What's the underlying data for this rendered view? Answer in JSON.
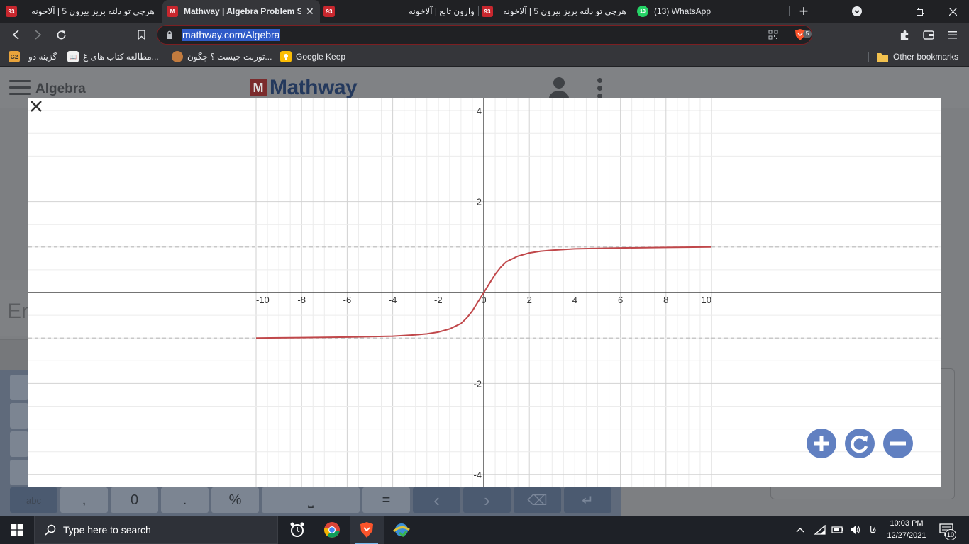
{
  "browser": {
    "tabs": [
      {
        "label": "هرچی تو دلته بریز بیرون 5 | آلاخونه",
        "favicon": "93-icon"
      },
      {
        "label": "Mathway | Algebra Problem Solver",
        "favicon": "mathway-icon",
        "active": true
      },
      {
        "label": "",
        "favicon": "93-icon"
      },
      {
        "label": "وارون تابع | آلاخونه",
        "favicon": "93-icon"
      },
      {
        "label": "هرچی تو دلته بریز بیرون 5 | آلاخونه",
        "favicon": "93-icon"
      },
      {
        "label": "(13) WhatsApp",
        "favicon": "whatsapp-icon",
        "badge": "13"
      }
    ],
    "new_tab": "+",
    "url": "mathway.com/Algebra",
    "brave_badge": "5",
    "bookmarks": [
      {
        "label": "گزینه دو"
      },
      {
        "label": "مطالعه کتاب های غ..."
      },
      {
        "label": "تورنت چیست ؟ چگون..."
      },
      {
        "label": "Google Keep"
      }
    ],
    "other_bookmarks": "Other bookmarks"
  },
  "mathway": {
    "section": "Algebra",
    "logo_text": "Mathway",
    "logo_mark": "M",
    "enter_partial": "En",
    "keypad": [
      "abc",
      ",",
      "0",
      ".",
      "%",
      "⎵",
      "=",
      "‹",
      "›",
      "⌫",
      "↵"
    ]
  },
  "graph": {
    "tick_labels_x": [
      "-10",
      "-8",
      "-6",
      "-4",
      "-2",
      "0",
      "2",
      "4",
      "6",
      "8",
      "10"
    ],
    "tick_labels_y": [
      "4",
      "2",
      "-2",
      "-4"
    ]
  },
  "chart_data": {
    "type": "line",
    "title": "",
    "xlabel": "",
    "ylabel": "",
    "xlim": [
      -10,
      10
    ],
    "ylim": [
      -4.2,
      4.2
    ],
    "x_ticks": [
      -10,
      -8,
      -6,
      -4,
      -2,
      0,
      2,
      4,
      6,
      8,
      10
    ],
    "y_ticks": [
      -4,
      -2,
      2,
      4
    ],
    "grid": true,
    "minor_grid_step": 0.5,
    "asymptotes_y": [
      1,
      -1
    ],
    "series": [
      {
        "color": "#c0474a",
        "x": [
          -10,
          -8,
          -6,
          -5,
          -4,
          -3,
          -2.5,
          -2,
          -1.5,
          -1,
          -0.75,
          -0.5,
          -0.25,
          0,
          0.25,
          0.5,
          0.75,
          1,
          1.5,
          2,
          2.5,
          3,
          4,
          5,
          6,
          8,
          10
        ],
        "y": [
          -1.0,
          -0.99,
          -0.98,
          -0.97,
          -0.96,
          -0.93,
          -0.91,
          -0.87,
          -0.8,
          -0.68,
          -0.56,
          -0.4,
          -0.2,
          0,
          0.2,
          0.4,
          0.56,
          0.68,
          0.8,
          0.87,
          0.91,
          0.93,
          0.96,
          0.97,
          0.98,
          0.99,
          1.0
        ]
      }
    ]
  },
  "taskbar": {
    "search_placeholder": "Type here to search",
    "lang": "فا",
    "time": "10:03 PM",
    "date": "12/27/2021",
    "notif_count": "10"
  }
}
